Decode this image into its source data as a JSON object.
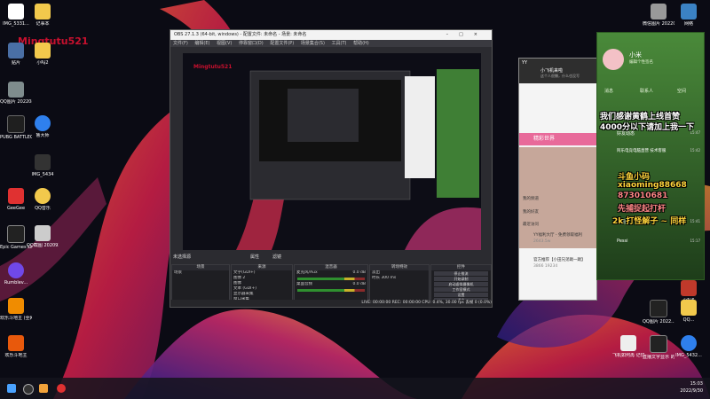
{
  "overlay_text": "Mingtutu521",
  "desktop_icons": [
    {
      "label": "IMG_5331...",
      "color": "#ffffff",
      "icon": "image-icon"
    },
    {
      "label": "记事本",
      "color": "#f2c94c",
      "icon": "folder-icon"
    },
    {
      "label": "贴片",
      "color": "#4a6fa5",
      "icon": "image-icon"
    },
    {
      "label": "小吗2",
      "color": "#f2c94c",
      "icon": "folder-icon"
    },
    {
      "label": "QQ图片 20220823...",
      "color": "#7f8c8d",
      "icon": "image-icon"
    },
    {
      "label": "PUBG BATTLEGR...",
      "color": "#1f1f1f",
      "icon": "game-icon"
    },
    {
      "label": "鲁大师",
      "color": "#2f80ed",
      "icon": "app-icon"
    },
    {
      "label": "IMG_5434",
      "color": "#333333",
      "icon": "image-icon"
    },
    {
      "label": "GeeGee",
      "color": "#e03131",
      "icon": "app-icon"
    },
    {
      "label": "QQ音乐",
      "color": "#f2c94c",
      "icon": "music-icon"
    },
    {
      "label": "Epic Games Launcher",
      "color": "#222222",
      "icon": "game-icon"
    },
    {
      "label": "QQ截图 2020926...",
      "color": "#cccccc",
      "icon": "image-icon"
    },
    {
      "label": "Rumblev...",
      "color": "#7048e8",
      "icon": "game-icon"
    },
    {
      "label": "欢乐斗地主 (全网大...",
      "color": "#f08c00",
      "icon": "game-icon"
    },
    {
      "label": "欢乐斗地主",
      "color": "#e8590c",
      "icon": "game-icon"
    }
  ],
  "right_desktop_icons": [
    {
      "label": "网络",
      "color": "#3b82c4",
      "icon": "network-icon"
    },
    {
      "label": "微信图片 20220...",
      "color": "#999999",
      "icon": "image-icon"
    },
    {
      "label": "小吗6",
      "color": "#c0392b",
      "icon": "image-icon"
    },
    {
      "label": "QQ图片 2022...",
      "color": "#222222",
      "icon": "image-icon"
    },
    {
      "label": "QQ...",
      "color": "#f2c94c",
      "icon": "folder-icon"
    },
    {
      "label": "飞机如何再 记忆",
      "color": "#eeeeee",
      "icon": "file-icon"
    },
    {
      "label": "直播文字显示 的插件",
      "color": "#222222",
      "icon": "file-icon"
    },
    {
      "label": "IMG_5432...",
      "color": "#2f80ed",
      "icon": "image-icon"
    }
  ],
  "obs": {
    "title": "OBS 27.1.3 (64-bit, windows) - 配置文件: 未命名 - 场景: 未命名",
    "menu": [
      "文件(F)",
      "编辑(E)",
      "视图(V)",
      "停靠窗口(D)",
      "配置文件(P)",
      "场景集合(S)",
      "工具(T)",
      "帮助(H)"
    ],
    "no_source": "未选择源",
    "properties": "属性",
    "filters": "滤镜",
    "docks": {
      "scenes": {
        "title": "场景",
        "items": [
          "场景"
        ]
      },
      "sources": {
        "title": "来源",
        "items": [
          "文字(GDI+)",
          "图像 2",
          "图像",
          "文本 (GDI+)",
          "显示器采集",
          "窗口采集"
        ]
      },
      "mixer": {
        "title": "混音器",
        "items": [
          {
            "name": "麦克风/Aux",
            "db": "0.0 dB"
          },
          {
            "name": "桌面音频",
            "db": "0.0 dB"
          }
        ]
      },
      "transitions": {
        "title": "转场特效",
        "type": "淡出",
        "duration_label": "时长",
        "duration": "300 ms"
      },
      "controls": {
        "title": "控件",
        "buttons": [
          "停止推流",
          "开始录制",
          "启动虚拟摄像机",
          "工作室模式",
          "设置",
          "退出"
        ]
      }
    },
    "status": "LIVE: 00:00:00   REC: 00:00:00   CPU: 0.4%, 30.00 fps   丢帧 0 (0.0%)"
  },
  "chat": {
    "header_title": "YY",
    "user": "小飞机来啦",
    "subtitle": "这个人很懒，什么也没写",
    "banner": "精彩世界",
    "menu": [
      "我的频道",
      "我的好友",
      "最近访问"
    ],
    "list": [
      {
        "title": "YY福利大厅 - 免费领取福利",
        "meta": "2643.5w"
      },
      {
        "title": "官方推荐【小田兄弟踢一踢】",
        "meta": "3866  19234"
      }
    ]
  },
  "contact_panel": {
    "name": "小米",
    "signature": "编辑个性签名",
    "tabs": [
      "消息",
      "联系人",
      "空间"
    ],
    "items": [
      {
        "name": "好友动态",
        "time": "15:47"
      },
      {
        "name": "阿乐电竞电脑直营 技术客服",
        "time": "15:42"
      },
      {
        "name": "订阅号",
        "time": "15:41"
      },
      {
        "name": "Pessi",
        "time": "15:17"
      }
    ]
  },
  "danmaku": [
    "我们感谢黄鹤上线首赞",
    "4000分以下请加上我一下",
    "斗鱼小码",
    "xiaoming88668",
    "873010681",
    "先捕捉起打杆",
    "2k 打怪解子 ~ 同样"
  ],
  "clock": {
    "time": "15:03",
    "date": "2022/9/30"
  }
}
